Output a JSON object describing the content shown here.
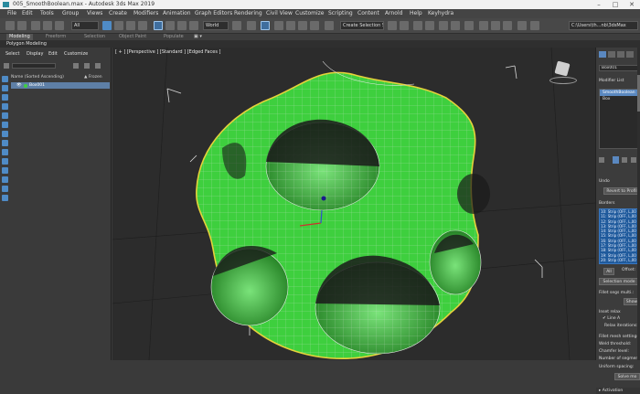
{
  "window": {
    "title": "005_SmoothBoolean.max - Autodesk 3ds Max 2019",
    "controls": [
      "–",
      "□",
      "✕"
    ]
  },
  "menu": [
    "File",
    "Edit",
    "Tools",
    "Group",
    "Views",
    "Create",
    "Modifiers",
    "Animation",
    "Graph Editors",
    "Rendering",
    "Civil View",
    "Customize",
    "Scripting",
    "Content",
    "Arnold",
    "Help",
    "Keyhydra"
  ],
  "toolbar": {
    "filter_value": "All",
    "coord_system": "World",
    "selection_set": "Create Selection Se",
    "path": "C:\\Users\\th...nb\\3dsMax"
  },
  "ribbon": {
    "tabs": [
      "Modeling",
      "Freeform",
      "Selection",
      "Object Paint",
      "Populate"
    ],
    "active_tab": "Modeling",
    "sub_label": "Polygon Modeling"
  },
  "scene_explorer": {
    "tabs": [
      "Select",
      "Display",
      "Edit",
      "Customize"
    ],
    "column_name": "Name (Sorted Ascending)",
    "column_frozen": "▲ Frozen",
    "objects": [
      {
        "name": "Box001"
      }
    ]
  },
  "viewport": {
    "label": "[ + ] [Perspective ] [Standard ] [Edged Faces ]"
  },
  "command_panel": {
    "object_name": "Box001",
    "modifier_list_label": "Modifier List",
    "stack_items": [
      "SmoothBoolean",
      "Box"
    ],
    "undo_label": "Undo",
    "revert_button": "Revert to Profil",
    "borders_label": "Borders",
    "borders": [
      "10: Strip (OFF, L,00",
      "11: Strip (OFF, L,00",
      "12: Strip (OFF, L,00",
      "13: Strip (OFF, L,00",
      "14: Strip (OFF, L,00",
      "15: Strip (OFF, L,00",
      "16: Strip (OFF, L,00",
      "17: Strip (OFF, L,00",
      "18: Strip (OFF, L,00",
      "19: Strip (OFF, L,00",
      "20: Strip (OFF, L,00"
    ],
    "all_button": "All",
    "offset_label": "Offset:",
    "selection_mode_button": "Selection mode",
    "fillet_segs_label": "Fillet segs multi.:",
    "show_button": "Show",
    "inset_relax_label": "Inset relax",
    "line_a_label": "Line A",
    "relax_iterations_label": "Relax iterations:",
    "fillet_mesh_label": "Fillet mesh settings",
    "weld_threshold_label": "Weld threshold:",
    "chamfer_level_label": "Chamfer level:",
    "number_segments_label": "Number of segmen",
    "uniform_spacing_label": "Uniform spacing:",
    "solve_button": "Solve mo",
    "activation_label": "Activation"
  },
  "colors": {
    "mesh_fill": "#3ecf3e",
    "mesh_wire": "#e8e8e8",
    "selection_outline": "#e6d23a",
    "accent": "#4f8bc6"
  }
}
